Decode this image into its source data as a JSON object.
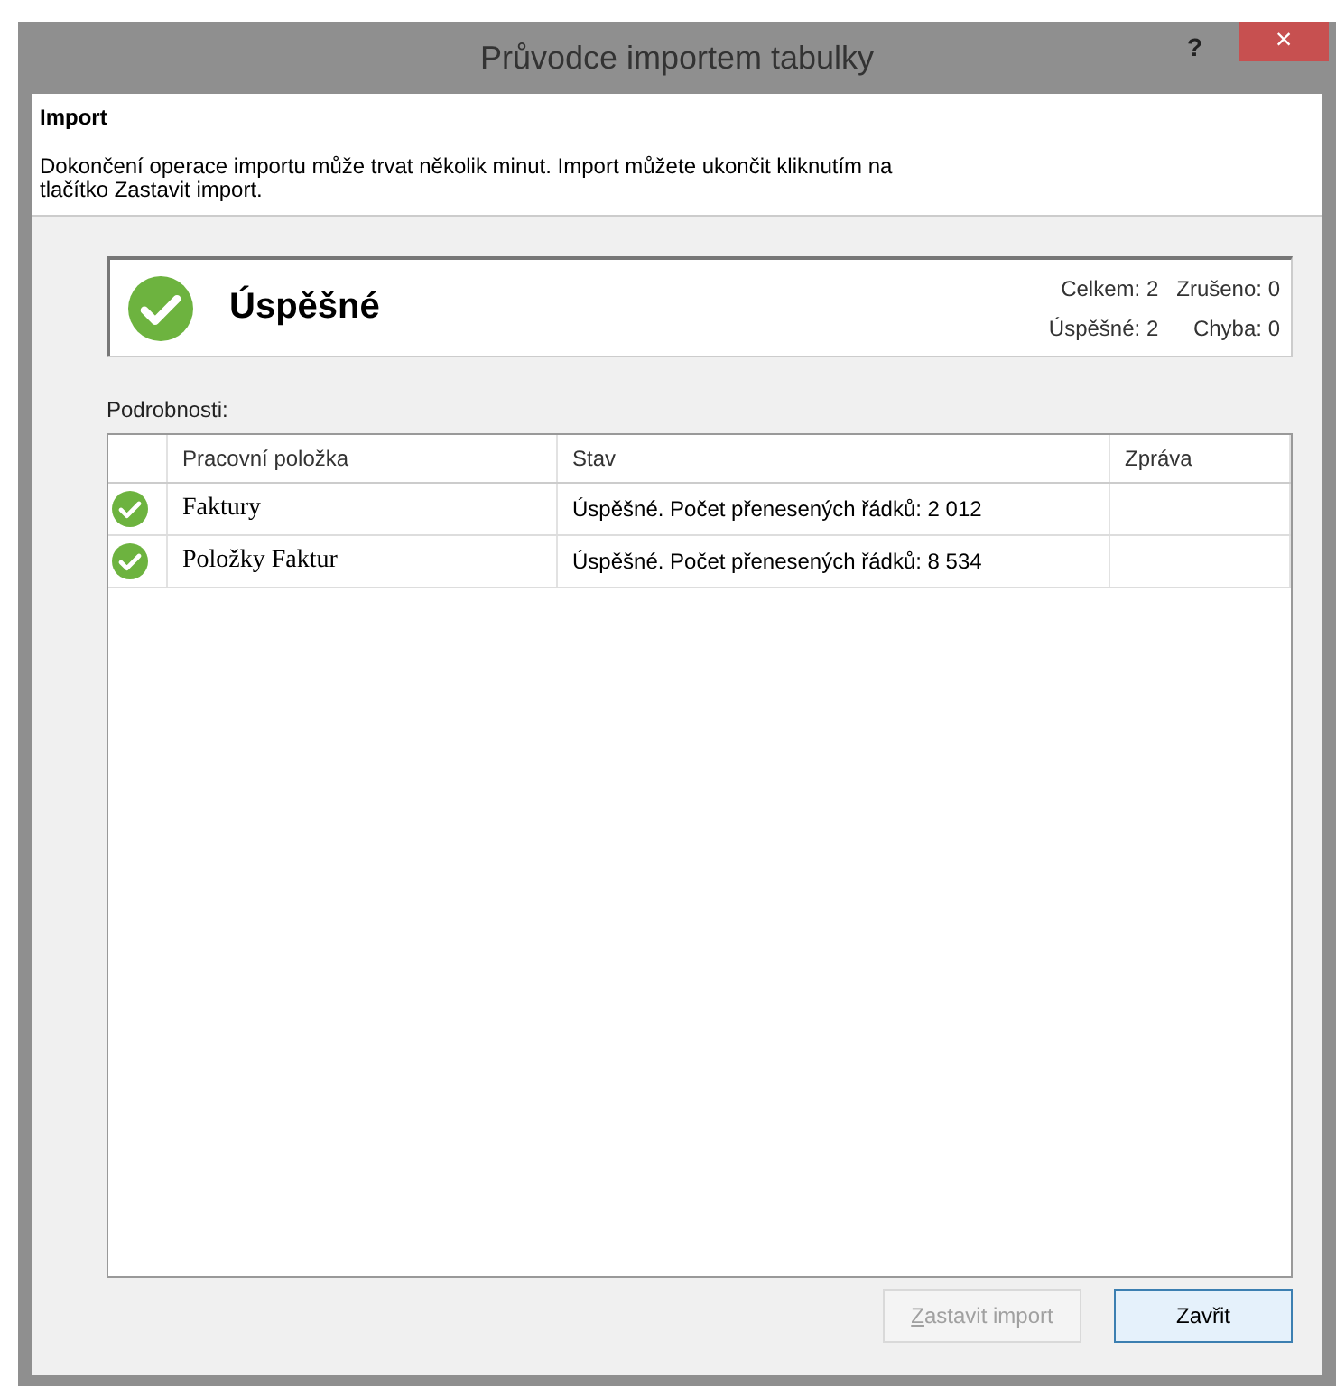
{
  "window": {
    "title": "Průvodce importem tabulky",
    "buttons": [
      "?",
      "×"
    ]
  },
  "header": {
    "title": "Import",
    "description": "Dokončení operace importu může trvat několik minut. Import můžete ukončit kliknutím na tlačítko Zastavit import."
  },
  "summary": {
    "kind": "success",
    "label": "Úspěšné",
    "counts": [
      "Celkem: 2",
      "Zrušeno: 0",
      "Úspěšné: 2",
      "Chyba: 0"
    ]
  },
  "details": {
    "label": "Podrobnosti:",
    "columns": [
      "Pracovní položka",
      "Stav",
      "Zpráva"
    ],
    "rows": [
      {
        "kind": "success",
        "item": "Faktury",
        "state": "Úspěšné. Počet přenesených řádků: 2 012"
      },
      {
        "kind": "success",
        "item": "Položky Faktur",
        "state": "Úspěšné. Počet přenesených řádků: 8 534"
      }
    ]
  },
  "buttons": [
    {
      "label": "Zastavit import",
      "disabled": true,
      "default": false
    },
    {
      "label": "Zavřit",
      "disabled": false,
      "default": true
    }
  ]
}
